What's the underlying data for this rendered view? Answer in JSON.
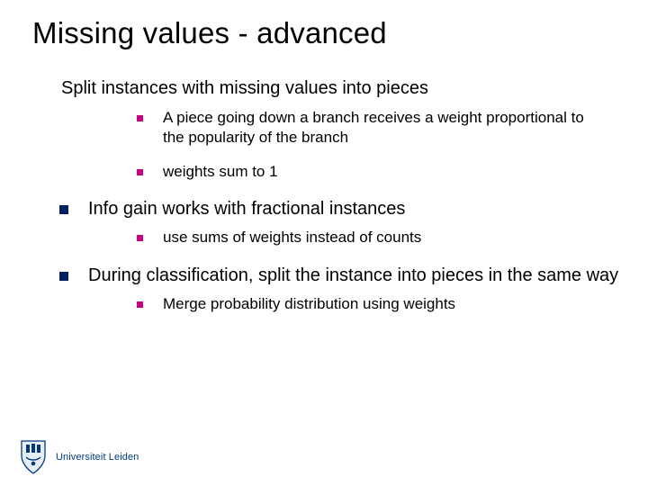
{
  "title": "Missing values - advanced",
  "sections": [
    {
      "text": "Split instances with missing values into pieces",
      "hasBullet": false,
      "subs": [
        "A piece going down a branch receives a weight proportional to the popularity of the branch",
        "weights sum to 1"
      ]
    },
    {
      "text": "Info gain works with fractional instances",
      "hasBullet": true,
      "subs": [
        "use sums of weights instead of counts"
      ]
    },
    {
      "text": "During classification, split the instance into pieces in the same way",
      "hasBullet": true,
      "subs": [
        "Merge probability distribution using weights"
      ]
    }
  ],
  "footer": {
    "wordmark": "Universiteit Leiden"
  },
  "colors": {
    "bullet1": "#002060",
    "bullet2": "#c6007e",
    "brand": "#003a7d"
  }
}
